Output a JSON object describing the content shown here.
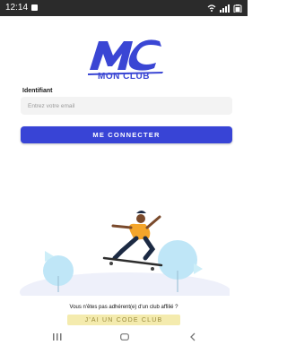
{
  "status_bar": {
    "time": "12:14"
  },
  "brand": {
    "name": "MON CLUB",
    "logo_text": "MC",
    "accent_color": "#3a46d4"
  },
  "login": {
    "identifier_label": "Identifiant",
    "email_placeholder": "Entrez votre email",
    "connect_label": "ME CONNECTER"
  },
  "signup": {
    "prompt": "Vous n'êtes pas adhérent(e) d'un club affilié ?",
    "code_button_label": "J'AI UN CODE CLUB"
  },
  "icons": [
    "image-notification-icon",
    "wifi-icon",
    "signal-icon",
    "battery-icon",
    "recent-apps-icon",
    "home-icon",
    "back-icon"
  ]
}
